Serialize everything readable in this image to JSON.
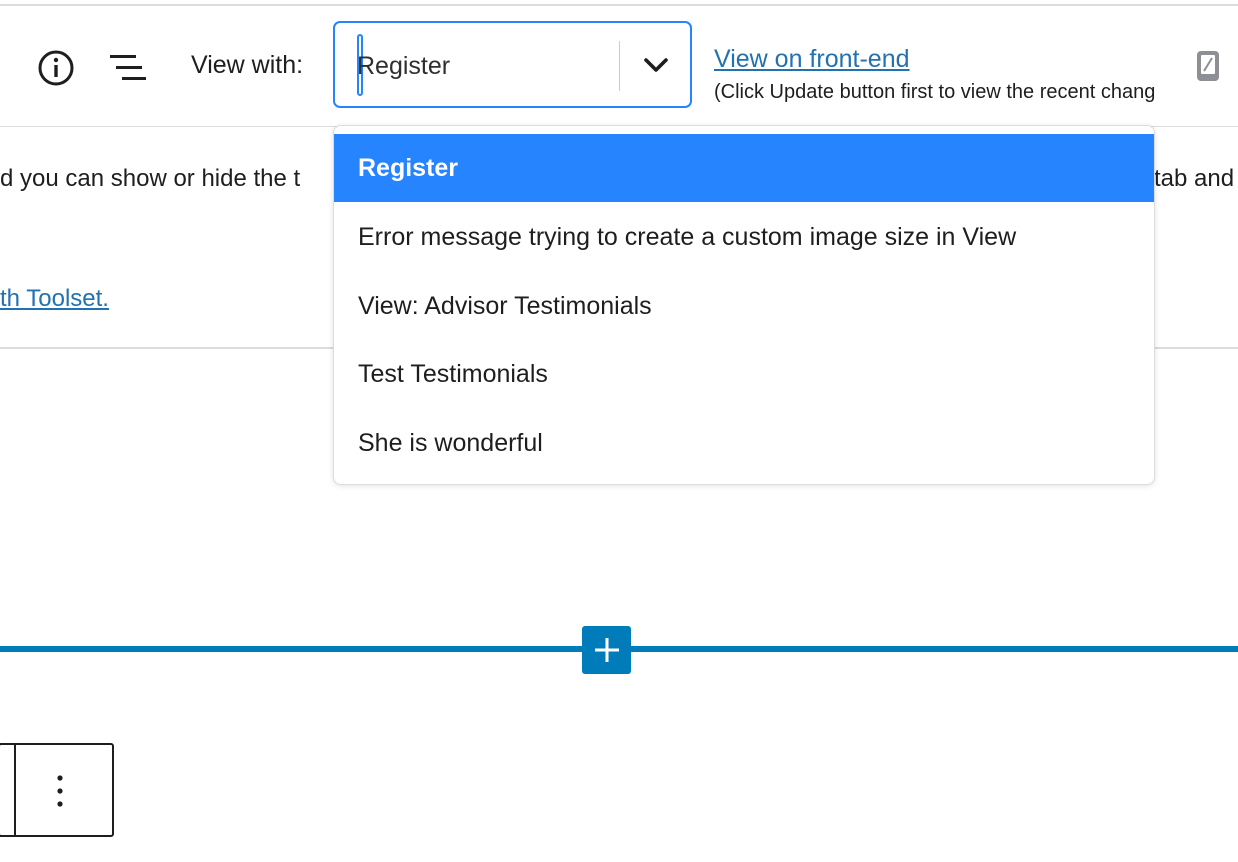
{
  "toolbar": {
    "view_with_label": "View with:",
    "selected_view": "Register",
    "front_end_link": "View on front-end",
    "front_end_note": "(Click Update button first to view the recent chang"
  },
  "dropdown": {
    "options": [
      "Register",
      "Error message trying to create a custom image size in View",
      "View: Advisor Testimonials",
      "Test Testimonials",
      "She is wonderful"
    ],
    "selected_index": 0
  },
  "content": {
    "text_left": "d you can show or hide the t",
    "text_right": "tab and",
    "link_partial": "th Toolset."
  },
  "colors": {
    "accent": "#2684ff",
    "wp_blue": "#007cba",
    "link": "#2271b1"
  },
  "icons": [
    "info-icon",
    "list-view-icon",
    "chevron-down-icon",
    "mobile-device-icon",
    "plus-icon",
    "more-vertical-icon"
  ]
}
